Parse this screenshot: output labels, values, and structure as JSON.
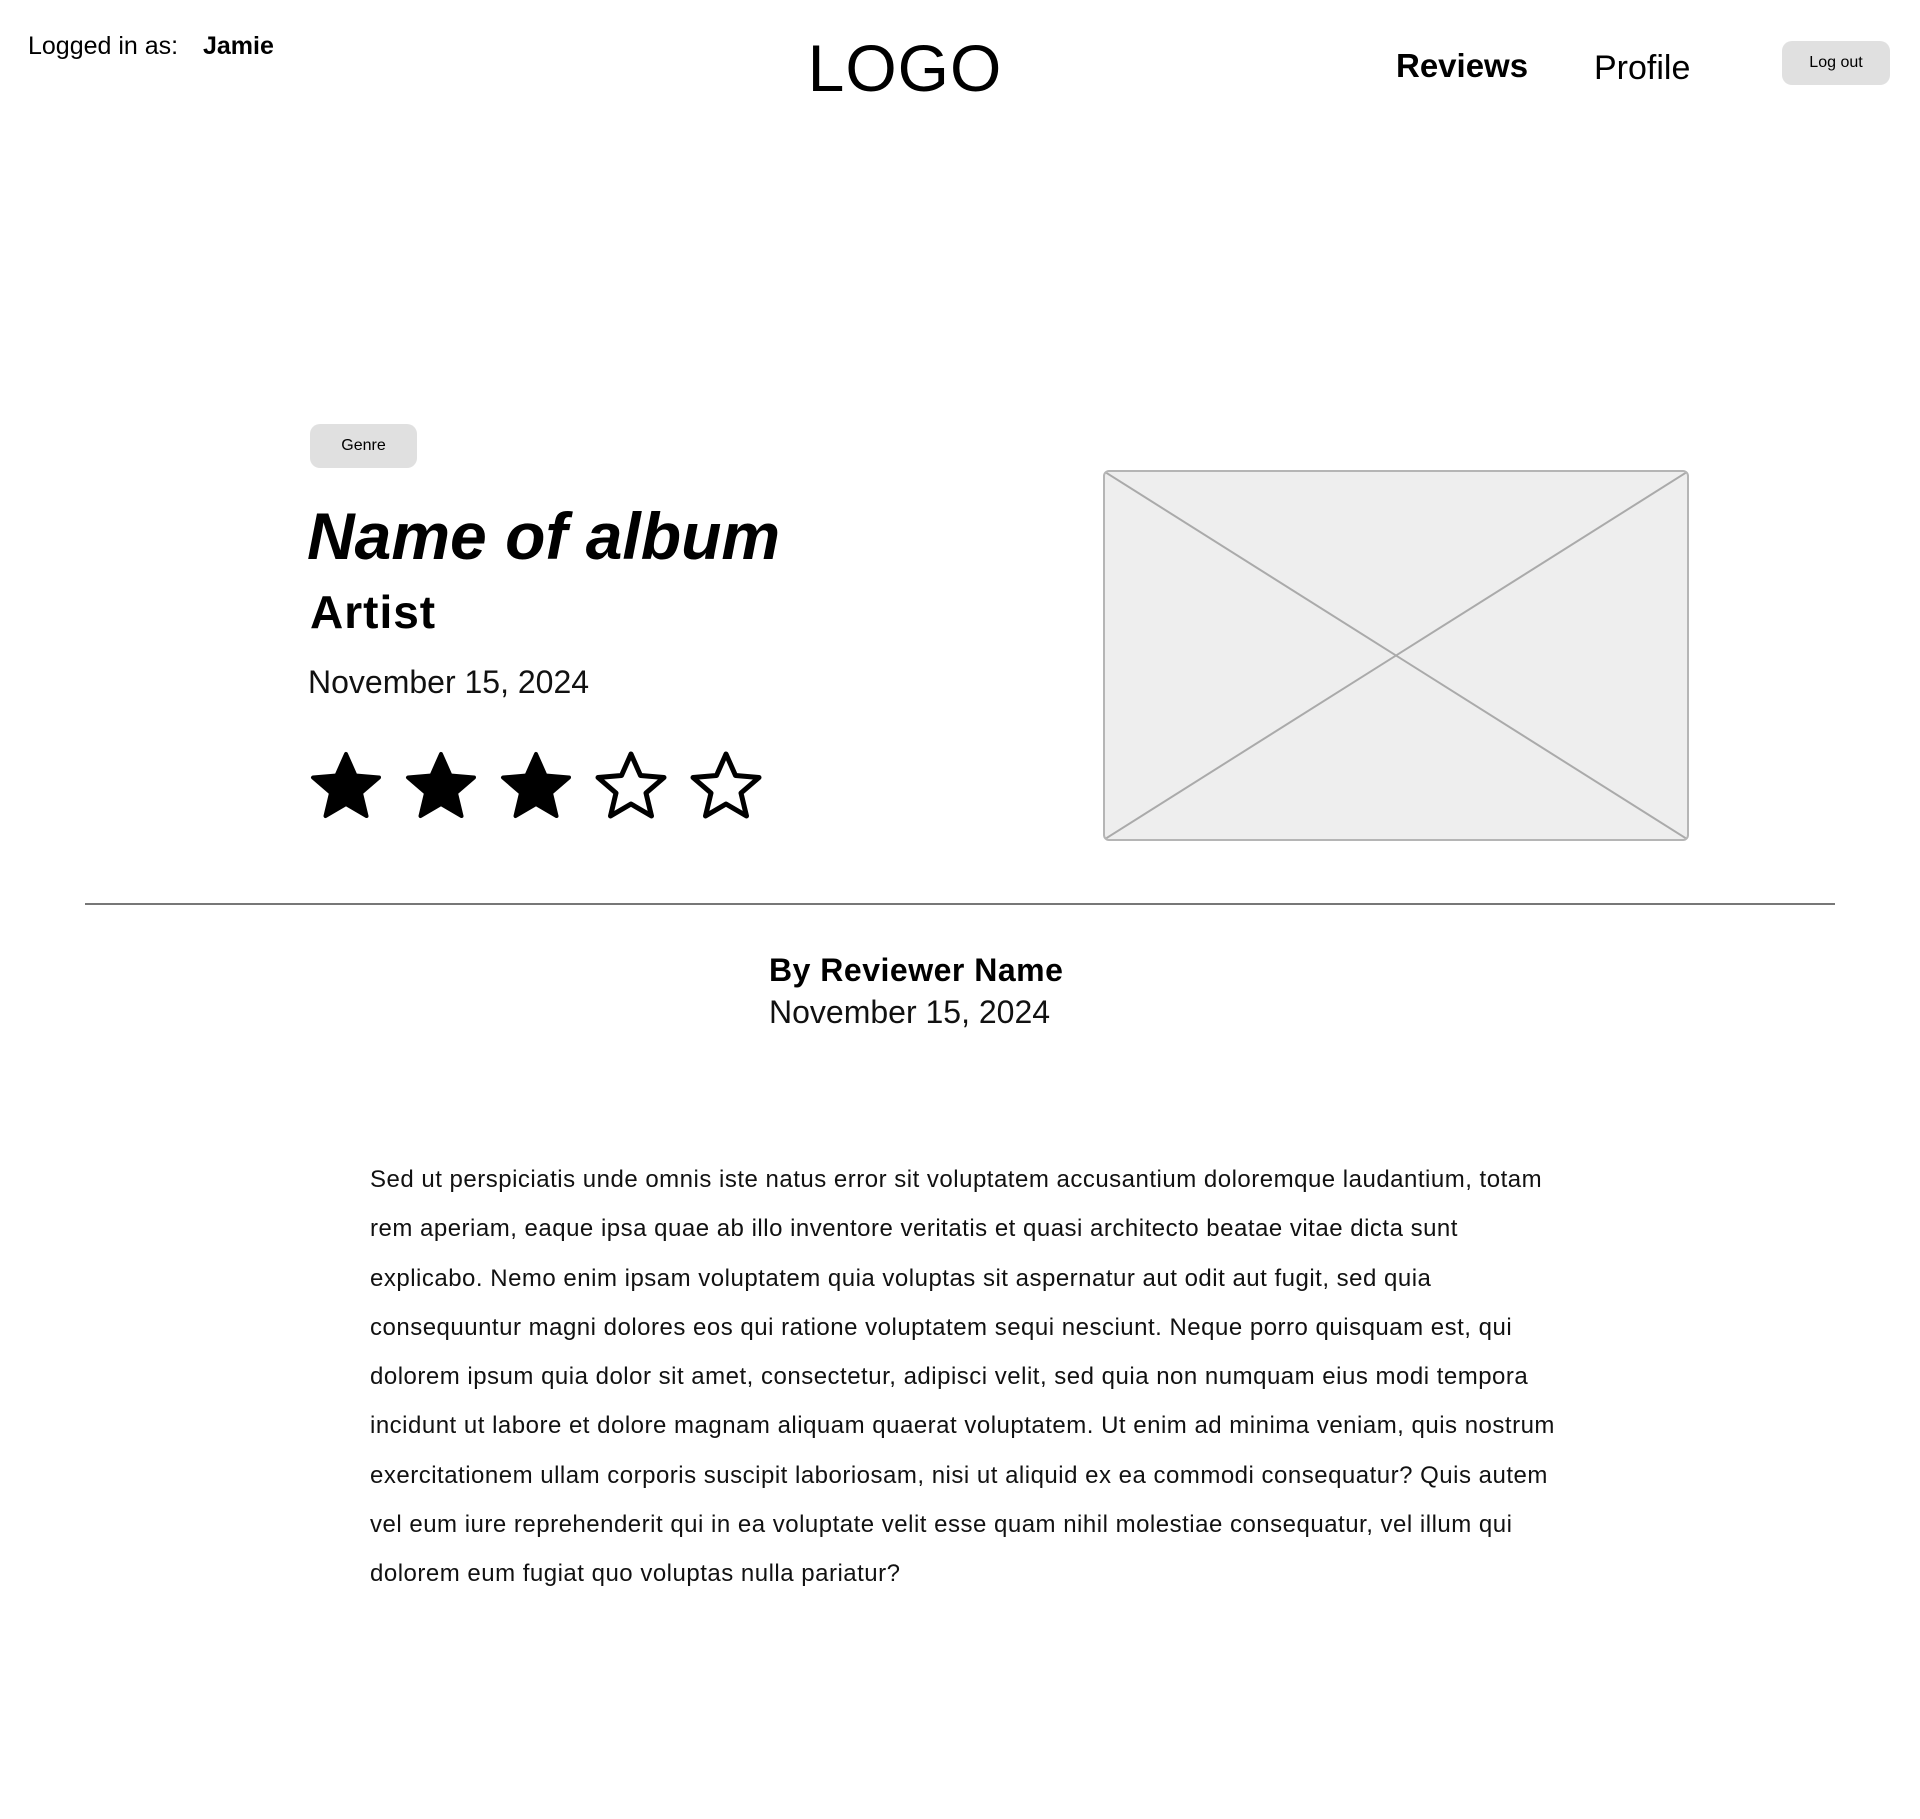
{
  "header": {
    "login_label": "Logged in as:",
    "username": "Jamie",
    "logo": "LOGO",
    "nav": {
      "reviews": "Reviews",
      "profile": "Profile"
    },
    "logout_label": "Log out"
  },
  "album": {
    "genre": "Genre",
    "title": "Name of album",
    "artist": "Artist",
    "date": "November 15, 2024",
    "rating": 3,
    "rating_max": 5,
    "image_icon": "image-placeholder-icon"
  },
  "review": {
    "reviewer": "By Reviewer Name",
    "date": "November 15, 2024",
    "body": "Sed ut perspiciatis unde omnis iste natus error sit voluptatem accusantium doloremque laudantium, totam rem aperiam, eaque ipsa quae ab illo inventore veritatis et quasi architecto beatae vitae dicta sunt explicabo. Nemo enim ipsam voluptatem quia voluptas sit aspernatur aut odit aut fugit, sed quia consequuntur magni dolores eos qui ratione voluptatem sequi nesciunt. Neque porro quisquam est, qui dolorem ipsum quia dolor sit amet, consectetur, adipisci velit, sed quia non numquam eius modi tempora incidunt ut labore et dolore magnam aliquam quaerat voluptatem. Ut enim ad minima veniam, quis nostrum exercitationem ullam corporis suscipit laboriosam, nisi ut aliquid ex ea commodi consequatur? Quis autem vel eum iure reprehenderit qui in ea voluptate velit esse quam nihil molestiae consequatur, vel illum qui dolorem eum fugiat quo voluptas nulla pariatur?"
  },
  "colors": {
    "button_bg": "#e0e0e0",
    "placeholder_bg": "#eeeeee",
    "placeholder_stroke": "#b5b5b5",
    "divider": "#777777"
  }
}
